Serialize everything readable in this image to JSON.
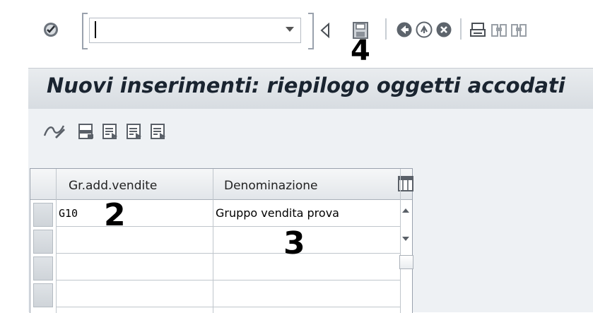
{
  "toolbar": {
    "command_value": "",
    "command_placeholder": "",
    "annotation": "4"
  },
  "title": "Nuovi inserimenti: riepilogo oggetti accodati",
  "table": {
    "columns": [
      "Gr.add.vendite",
      "Denominazione"
    ],
    "rows": [
      {
        "code": "G10",
        "name": "Gruppo vendita prova"
      },
      {
        "code": "",
        "name": ""
      },
      {
        "code": "",
        "name": ""
      },
      {
        "code": "",
        "name": ""
      }
    ],
    "annotation_code": "2",
    "annotation_name": "3"
  },
  "icons": {
    "toolbar": [
      "enter-icon",
      "history-dropdown-icon",
      "back-triangle-icon",
      "save-icon",
      "back-icon",
      "exit-icon",
      "cancel-icon",
      "print-icon",
      "find-icon",
      "find-next-icon"
    ],
    "app_toolbar": [
      "change-display-icon",
      "new-entries-icon",
      "copy-as-icon",
      "delete-icon",
      "undo-change-icon"
    ]
  },
  "colors": {
    "title_bg": "#d7dce1",
    "app_bg": "#eef1f4",
    "toolbar_icon": "#5a6068"
  }
}
